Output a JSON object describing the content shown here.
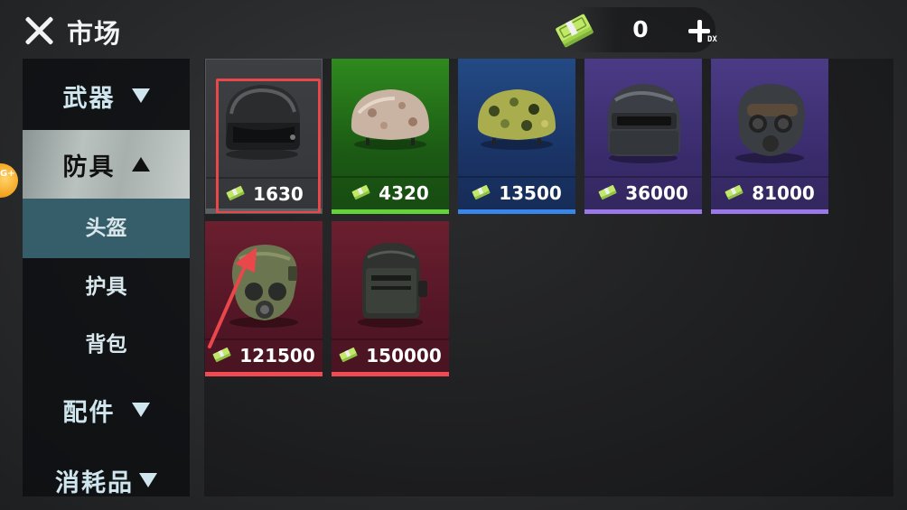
{
  "header": {
    "title": "市场",
    "currency_value": "0",
    "add_badge_text": "DX"
  },
  "sidebar": {
    "badge_text": "G+",
    "categories": [
      {
        "label": "武器",
        "expanded": false
      },
      {
        "label": "防具",
        "expanded": true
      },
      {
        "label": "配件",
        "expanded": false
      },
      {
        "label": "消耗品",
        "expanded": false
      }
    ],
    "subcategories": [
      {
        "label": "头盔",
        "active": true
      },
      {
        "label": "护具",
        "active": false
      },
      {
        "label": "背包",
        "active": false
      }
    ]
  },
  "items": [
    {
      "price": "1630",
      "rarity": "grey",
      "icon": "open-face-helmet-icon",
      "selected": true
    },
    {
      "price": "4320",
      "rarity": "green",
      "icon": "desert-camo-helmet-icon",
      "selected": false
    },
    {
      "price": "13500",
      "rarity": "blue",
      "icon": "woodland-camo-helmet-icon",
      "selected": false
    },
    {
      "price": "36000",
      "rarity": "purple",
      "icon": "level3-spetsnaz-helmet-icon",
      "selected": false
    },
    {
      "price": "81000",
      "rarity": "purple",
      "icon": "gasmask-helmet-icon",
      "selected": false
    },
    {
      "price": "121500",
      "rarity": "red",
      "icon": "tactical-gasmask-helmet-icon",
      "selected": false
    },
    {
      "price": "150000",
      "rarity": "red",
      "icon": "visor-armored-helmet-icon",
      "selected": false
    }
  ],
  "colors": {
    "rarity_grey": "#5d6064",
    "rarity_green": "#64d23a",
    "rarity_blue": "#3a86e8",
    "rarity_purple": "#9a78e8",
    "rarity_red": "#f04a52",
    "selection_outline": "#e9474a",
    "active_subcategory": "#355d6a"
  }
}
